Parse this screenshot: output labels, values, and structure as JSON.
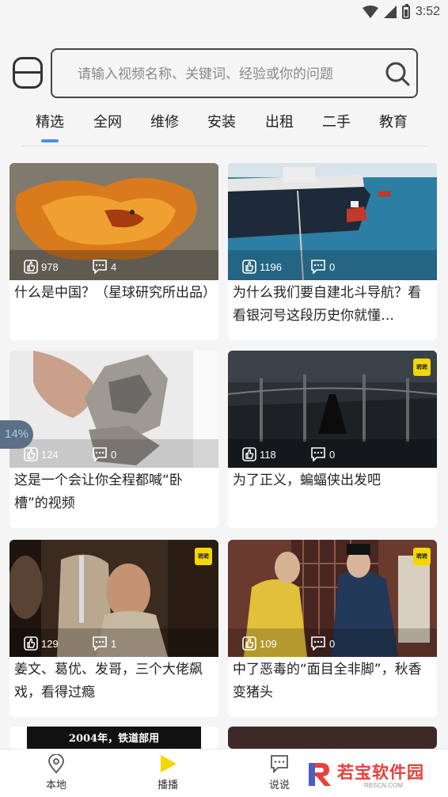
{
  "status": {
    "time": "3:52"
  },
  "search": {
    "placeholder": "请输入视频名称、关键词、经验或你的问题"
  },
  "tabs": [
    {
      "label": "精选"
    },
    {
      "label": "全网"
    },
    {
      "label": "维修"
    },
    {
      "label": "安装"
    },
    {
      "label": "出租"
    },
    {
      "label": "二手"
    },
    {
      "label": "教育"
    }
  ],
  "videos": [
    {
      "title": "什么是中国？（星球研究所出品）",
      "likes": "978",
      "comments": "4"
    },
    {
      "title": "为什么我们要自建北斗导航？看看银河号这段历史你就懂…",
      "likes": "1196",
      "comments": "0"
    },
    {
      "title": "这是一个会让你全程都喊“卧槽”的视频",
      "likes": "124",
      "comments": "0"
    },
    {
      "title": "为了正义，蝙蝠侠出发吧",
      "likes": "118",
      "comments": "0",
      "badge": "聘聘"
    },
    {
      "title": "姜文、葛优、发哥，三个大佬飙戏，看得过瘾",
      "likes": "129",
      "comments": "1",
      "badge": "聘聘"
    },
    {
      "title": "中了恶毒的“面目全非脚”，秋香变猪头",
      "likes": "109",
      "comments": "0",
      "badge": "聘聘"
    }
  ],
  "partial_thumb_text": "2004年，铁道部用",
  "progress_badge": "14%",
  "bottom_nav": [
    {
      "label": "本地",
      "icon": "location-pin-icon"
    },
    {
      "label": "播播",
      "icon": "play-triangle-icon"
    },
    {
      "label": "说说",
      "icon": "chat-bubble-icon"
    }
  ],
  "watermark": {
    "name": "若宝软件园",
    "url": "RBSCN.COM"
  },
  "colors": {
    "accent": "#4a90e2",
    "play": "#f5d600",
    "watermark": "#e8403a"
  }
}
